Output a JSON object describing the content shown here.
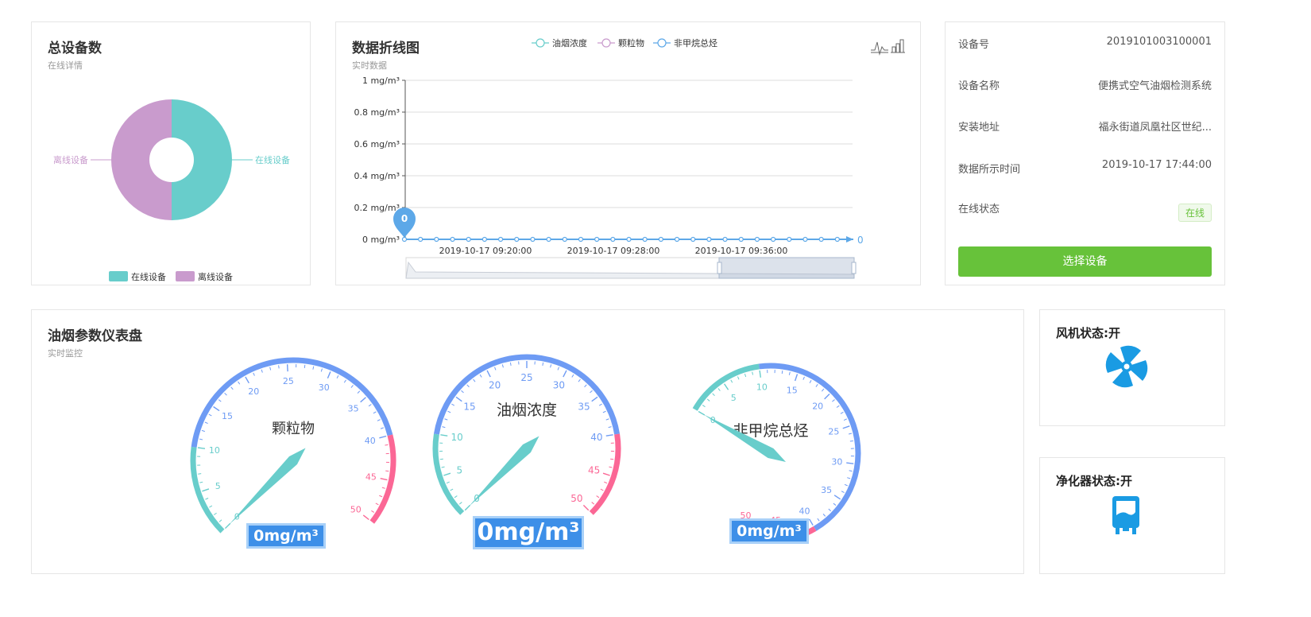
{
  "total_devices": {
    "title": "总设备数",
    "subtitle": "在线详情",
    "labels": {
      "online": "在线设备",
      "offline": "离线设备"
    },
    "legend": [
      "在线设备",
      "离线设备"
    ],
    "colors": {
      "online": "#68cdcb",
      "offline": "#c99bcd"
    },
    "chart_data": {
      "type": "pie",
      "style": "donut",
      "slices": [
        {
          "name": "在线设备",
          "value": 50
        },
        {
          "name": "离线设备",
          "value": 50
        }
      ]
    }
  },
  "line_chart": {
    "title": "数据折线图",
    "subtitle": "实时数据",
    "legend": [
      "油烟浓度",
      "颗粒物",
      "非甲烷总烃"
    ],
    "legend_colors": [
      "#68cdcb",
      "#c99bcd",
      "#5da8e8"
    ],
    "toolbox_icons": [
      "line-chart-icon",
      "bar-chart-icon"
    ],
    "marker_label": "0",
    "end_label": "0",
    "chart_data": {
      "type": "line",
      "y_ticks": [
        "0 mg/m³",
        "0.2 mg/m³",
        "0.4 mg/m³",
        "0.6 mg/m³",
        "0.8 mg/m³",
        "1 mg/m³"
      ],
      "x_ticks": [
        "2019-10-17 09:20:00",
        "2019-10-17 09:28:00",
        "2019-10-17 09:36:00"
      ],
      "ylim": [
        0,
        1
      ],
      "grid": true,
      "legend_position": "top",
      "series": [
        {
          "name": "非甲烷总烃",
          "values": [
            0,
            0,
            0,
            0,
            0,
            0,
            0,
            0,
            0,
            0,
            0,
            0,
            0,
            0,
            0,
            0,
            0,
            0,
            0,
            0,
            0,
            0,
            0,
            0,
            0,
            0,
            0,
            0,
            0
          ]
        }
      ],
      "markers": [
        {
          "type": "max",
          "label": "0"
        }
      ]
    }
  },
  "device_info": {
    "rows": [
      {
        "key": "设备号",
        "value": "2019101003100001"
      },
      {
        "key": "设备名称",
        "value": "便携式空气油烟检测系统"
      },
      {
        "key": "安装地址",
        "value": "福永街道凤凰社区世纪..."
      },
      {
        "key": "数据所示时间",
        "value": "2019-10-17 17:44:00"
      }
    ],
    "status_label": "在线状态",
    "status_value": "在线",
    "button_label": "选择设备"
  },
  "gauges_panel": {
    "title": "油烟参数仪表盘",
    "subtitle": "实时监控",
    "colors": {
      "low": "#68cdcb",
      "mid": "#6e9bf4",
      "high": "#fb6795"
    },
    "gauges": [
      {
        "name": "颗粒物",
        "value": 0,
        "display": "0mg/m³",
        "min": 0,
        "max": 50,
        "ticks": [
          "0",
          "5",
          "10",
          "15",
          "20",
          "25",
          "30",
          "35",
          "40",
          "45",
          "50"
        ]
      },
      {
        "name": "油烟浓度",
        "value": 0,
        "display": "0mg/m³",
        "min": 0,
        "max": 50,
        "ticks": [
          "0",
          "5",
          "10",
          "15",
          "20",
          "25",
          "30",
          "35",
          "40",
          "45",
          "50"
        ]
      },
      {
        "name": "非甲烷总烃",
        "value": 0,
        "display": "0mg/m³",
        "min": 0,
        "max": 50,
        "ticks": [
          "0",
          "5",
          "10",
          "15",
          "20",
          "25",
          "30",
          "35",
          "40",
          "45",
          "50"
        ]
      }
    ]
  },
  "fan_status": {
    "title": "风机状态:开",
    "icon": "fan-icon",
    "color": "#1a9be3"
  },
  "purifier_status": {
    "title": "净化器状态:开",
    "icon": "purifier-icon",
    "color": "#1a9be3"
  }
}
